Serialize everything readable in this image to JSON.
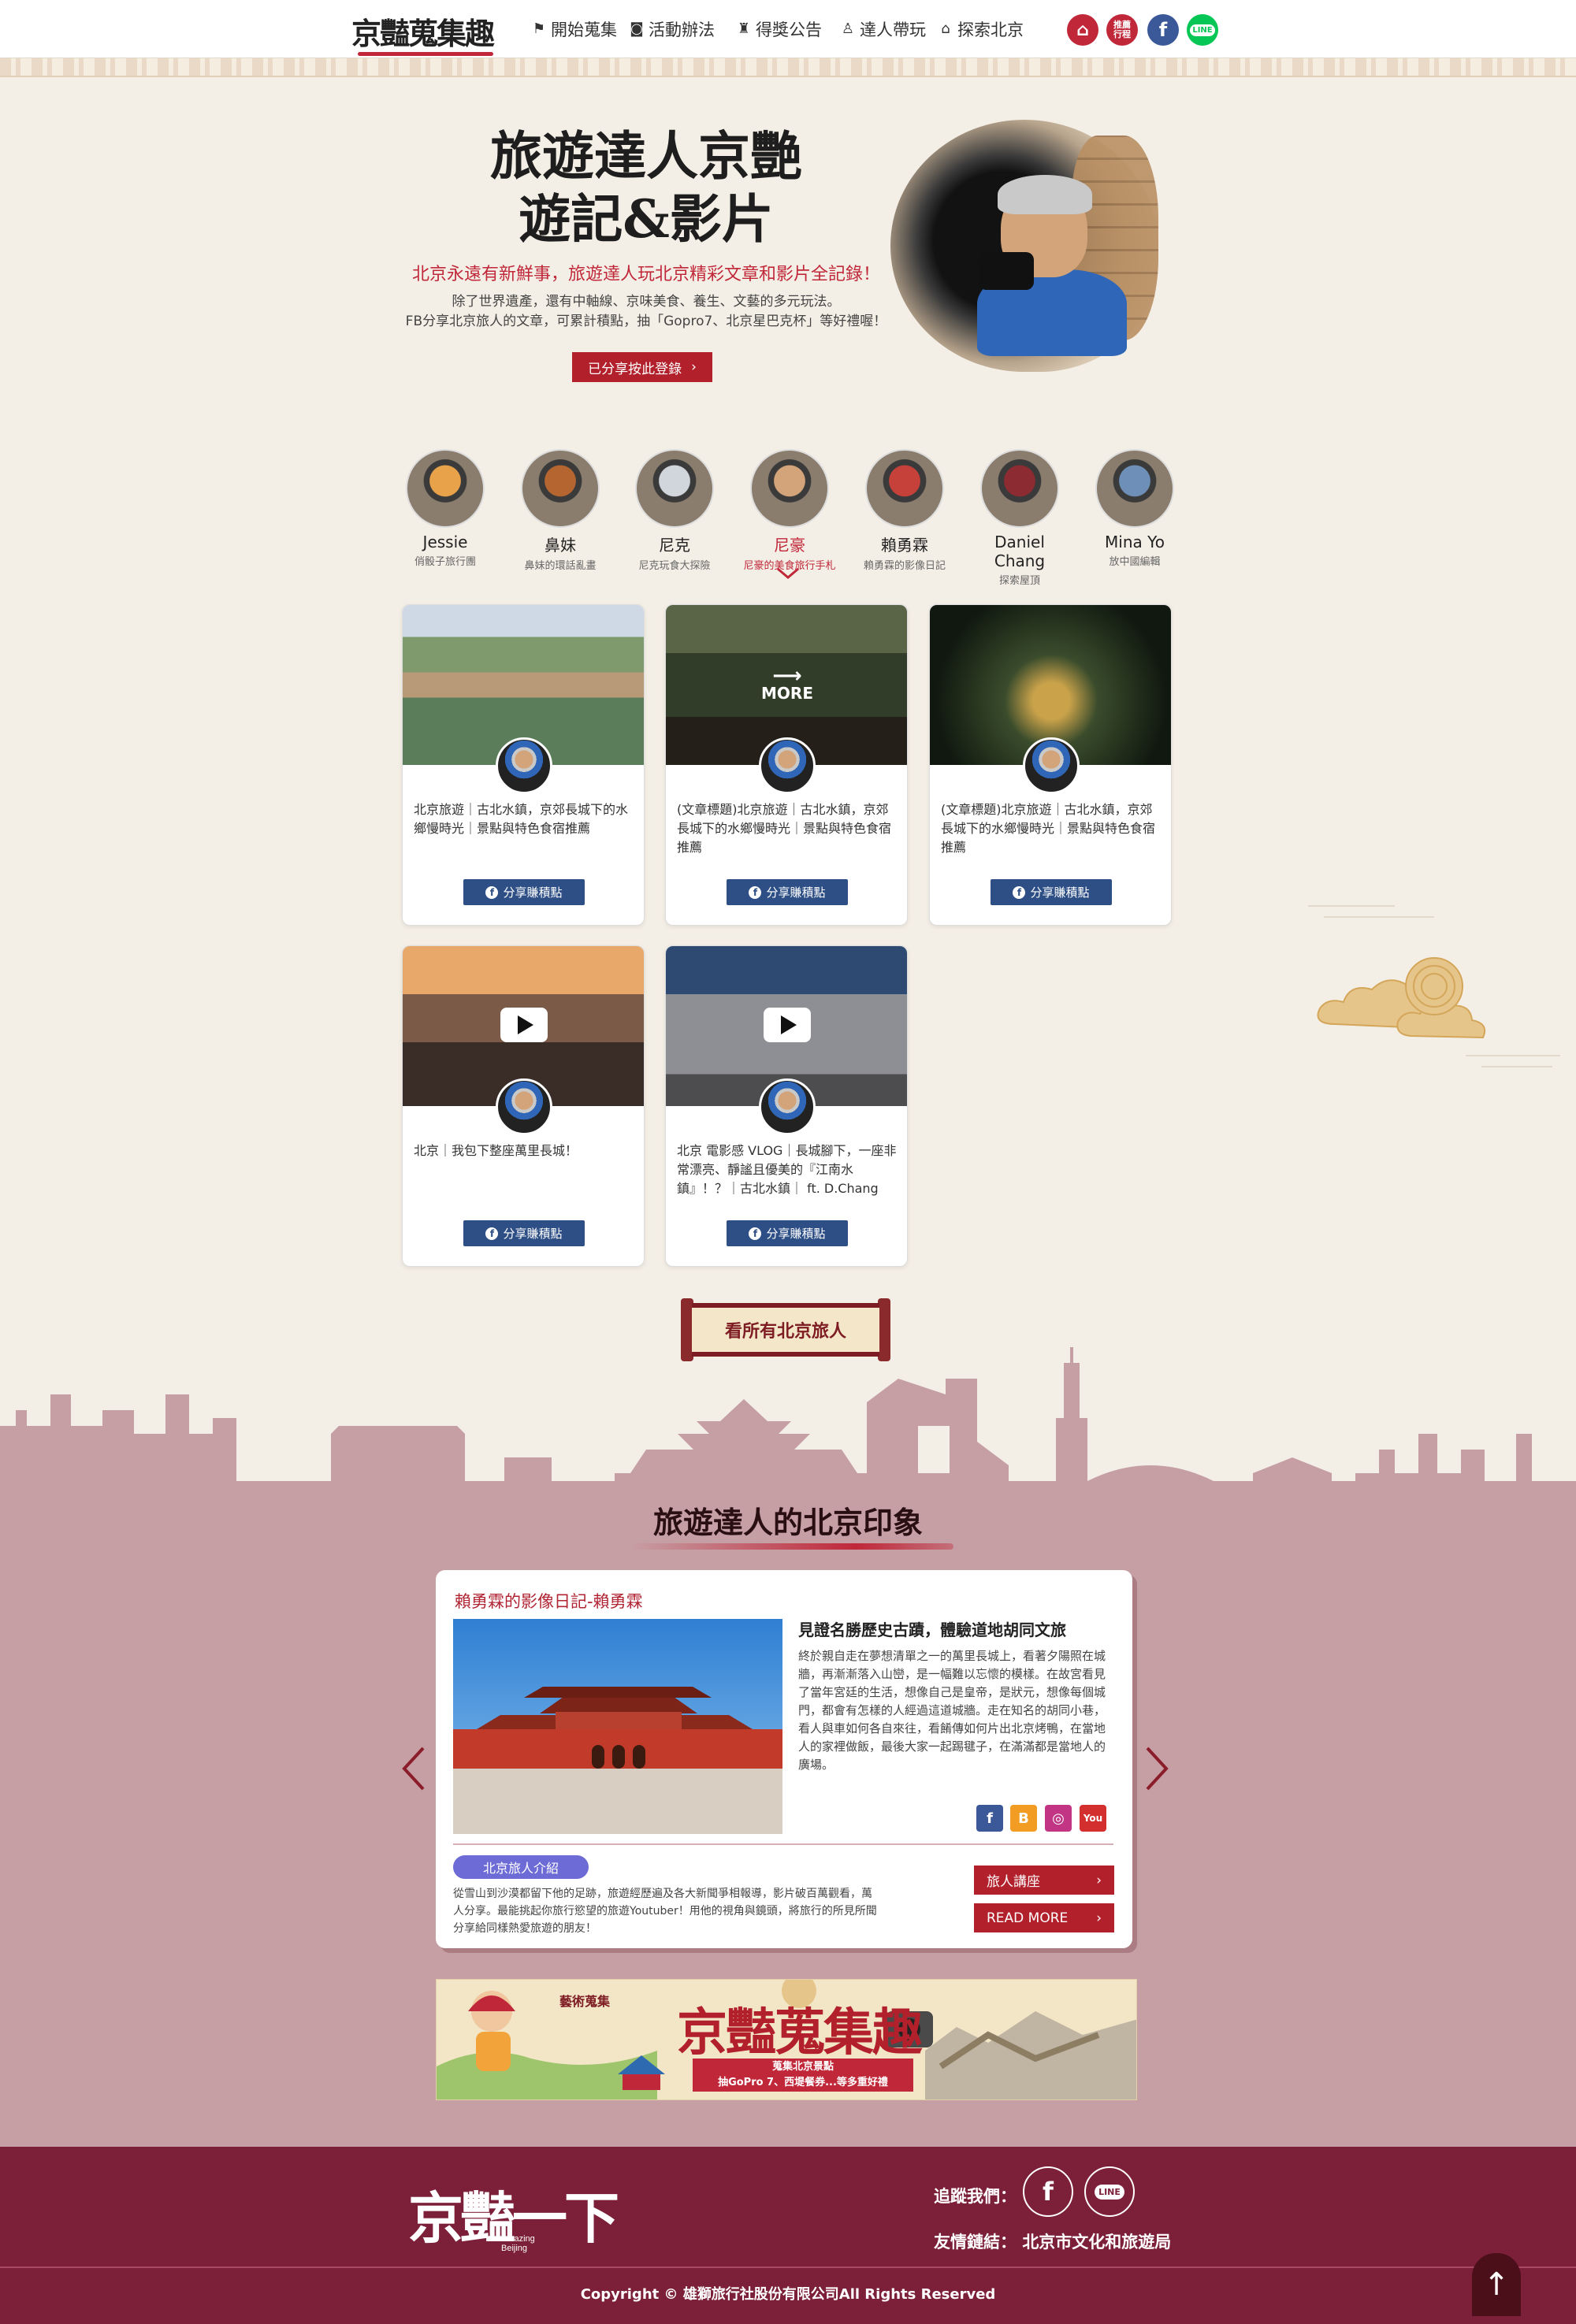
{
  "header": {
    "logo": "京豔蒐集趣",
    "nav": [
      {
        "icon": "flag-icon",
        "label": "開始蒐集"
      },
      {
        "icon": "badge-icon",
        "label": "活動辦法"
      },
      {
        "icon": "trophy-icon",
        "label": "得獎公告"
      },
      {
        "icon": "walker-icon",
        "label": "達人帶玩"
      },
      {
        "icon": "temple-icon",
        "label": "探索北京"
      }
    ],
    "circle_buttons": [
      {
        "icon": "home-icon",
        "color": "#c0283a"
      },
      {
        "label": "推薦行程",
        "color": "#c0283a"
      },
      {
        "icon": "facebook-icon",
        "label": "f",
        "color": "#3b5998"
      },
      {
        "icon": "line-icon",
        "label": "LINE",
        "color": "#06c755"
      }
    ]
  },
  "hero": {
    "title_line1": "旅遊達人京艷",
    "title_line2": "遊記&影片",
    "subtitle": "北京永遠有新鮮事，旅遊達人玩北京精彩文章和影片全記錄！",
    "desc_line1": "除了世界遺產，還有中軸線、京味美食、養生、文藝的多元玩法。",
    "desc_line2": "FB分享北京旅人的文章，可累計積點，抽「Gopro7、北京星巴克杯」等好禮喔！",
    "cta": "已分享按此登錄"
  },
  "travelers": [
    {
      "name": "Jessie",
      "tagline": "俏骰子旅行團",
      "selected": false,
      "color": "#e8a24a"
    },
    {
      "name": "鼻妹",
      "tagline": "鼻妹的環話亂畫",
      "selected": false,
      "color": "#b5652f"
    },
    {
      "name": "尼克",
      "tagline": "尼克玩食大探險",
      "selected": false,
      "color": "#d0d6dc"
    },
    {
      "name": "尼豪",
      "tagline": "尼豪的美食旅行手札",
      "selected": true,
      "color": "#d3a37a"
    },
    {
      "name": "賴勇霖",
      "tagline": "賴勇霖的影像日記",
      "selected": false,
      "color": "#c7413b"
    },
    {
      "name": "Daniel Chang",
      "tagline": "探索屋頂",
      "selected": false,
      "color": "#8c2b31"
    },
    {
      "name": "Mina Yo",
      "tagline": "放中國編輯",
      "selected": false,
      "color": "#6d8fb8"
    }
  ],
  "posts": [
    {
      "text": "北京旅遊｜古北水鎮，京郊長城下的水鄉慢時光｜景點與特色食宿推薦",
      "button": "分享賺積點",
      "type": "article"
    },
    {
      "text": "(文章標題)北京旅遊｜古北水鎮，京郊長城下的水鄉慢時光｜景點與特色食宿推薦",
      "button": "分享賺積點",
      "type": "article",
      "overlay": "MORE"
    },
    {
      "text": "(文章標題)北京旅遊｜古北水鎮，京郊長城下的水鄉慢時光｜景點與特色食宿推薦",
      "button": "分享賺積點",
      "type": "article"
    },
    {
      "text": "北京｜我包下整座萬里長城！",
      "button": "分享賺積點",
      "type": "video"
    },
    {
      "text": "北京 電影感 VLOG｜長城腳下，一座非常漂亮、靜謐且優美的『江南水鎮』！？｜古北水鎮｜ ft. D.Chang",
      "button": "分享賺積點",
      "type": "video"
    }
  ],
  "see_all": "看所有北京旅人",
  "impression": {
    "section_title": "旅遊達人的北京印象",
    "panel_heading": "賴勇霖的影像日記-賴勇霖",
    "article_title": "見證名勝歷史古蹟，體驗道地胡同文旅",
    "article_body": "終於親自走在夢想清單之一的萬里長城上，看著夕陽照在城牆，再漸漸落入山巒，是一幅難以忘懷的模樣。在故宮看見了當年宮廷的生活，想像自己是皇帝，是狀元，想像每個城門，都會有怎樣的人經過這道城牆。走在知名的胡同小巷，看人與車如何各自來往，看餚傳如何片出北京烤鴨，在當地人的家裡做飯，最後大家一起踢毽子，在滿滿都是當地人的廣場。",
    "social": [
      {
        "icon": "facebook-icon",
        "label": "f",
        "color": "#3b5998"
      },
      {
        "icon": "blogger-icon",
        "label": "B",
        "color": "#f39c24"
      },
      {
        "icon": "instagram-icon",
        "label": "◎",
        "color": "#c13584"
      },
      {
        "icon": "youtube-icon",
        "label": "You",
        "color": "#d32f2f"
      }
    ],
    "intro_tag": "北京旅人介紹",
    "intro_text": "從雪山到沙漠都留下他的足跡，旅遊經歷遍及各大新聞爭相報導，影片破百萬觀看，萬人分享。最能挑起你旅行慾望的旅遊Youtuber！用他的視角與鏡頭，將旅行的所見所聞分享給同樣熱愛旅遊的朋友！",
    "btn_lecture": "旅人講座",
    "btn_more": "READ MORE"
  },
  "banner": {
    "stamp": "藝術蒐集",
    "title": "京豔蒐集趣",
    "line1": "蒐集北京景點",
    "line2": "抽GoPro 7、西堤餐券...等多重好禮"
  },
  "footer": {
    "logo": "京豔一下",
    "logo_en1": "Amazing",
    "logo_en2": "Beijing",
    "follow_label": "追蹤我們：",
    "links_label": "友情鏈結：",
    "link": "北京市文化和旅遊局",
    "copyright": "Copyright © 雄獅旅行社股份有限公司All Rights Reserved",
    "to_top": "↑"
  }
}
